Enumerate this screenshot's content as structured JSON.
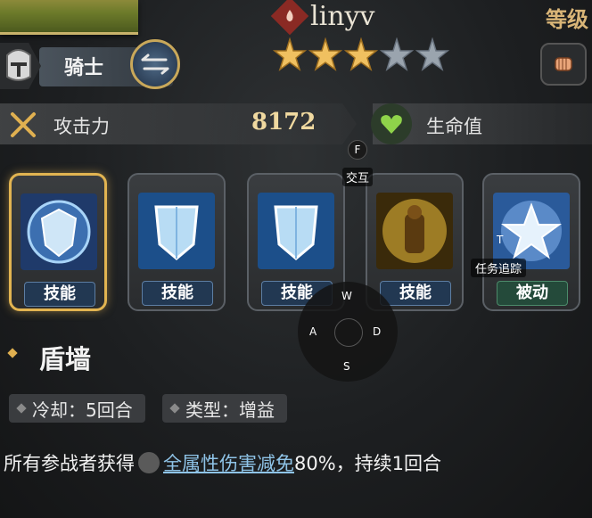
{
  "header": {
    "player_name": "linyv",
    "level_label": "等级",
    "stars_filled": 3,
    "stars_total": 5
  },
  "class_bar": {
    "class_name": "骑士"
  },
  "stats": {
    "attack_label": "攻击力",
    "attack_value": "8172",
    "hp_label": "生命值"
  },
  "hints": {
    "interact_key": "F",
    "interact_label": "交互",
    "task_key": "T",
    "task_label": "任务追踪",
    "dpad": {
      "up": "W",
      "left": "A",
      "right": "D",
      "down": "S"
    }
  },
  "skills": [
    {
      "label": "技能",
      "selected": true,
      "icon": "shield-round-icon"
    },
    {
      "label": "技能",
      "selected": false,
      "icon": "shield-icon"
    },
    {
      "label": "技能",
      "selected": false,
      "icon": "shield-icon"
    },
    {
      "label": "技能",
      "selected": false,
      "icon": "golden-warrior-icon"
    },
    {
      "label": "被动",
      "selected": false,
      "icon": "star-shield-icon"
    }
  ],
  "detail": {
    "title": "盾墙",
    "cooldown": "冷却：5回合",
    "type": "类型：增益",
    "desc_prefix": "所有参战者获得",
    "desc_link": "全属性伤害减免",
    "desc_suffix": "80%，持续1回合"
  },
  "colors": {
    "accent_gold": "#e2b451",
    "link_blue": "#8fc4e8",
    "hp_green": "#8fd34a"
  }
}
